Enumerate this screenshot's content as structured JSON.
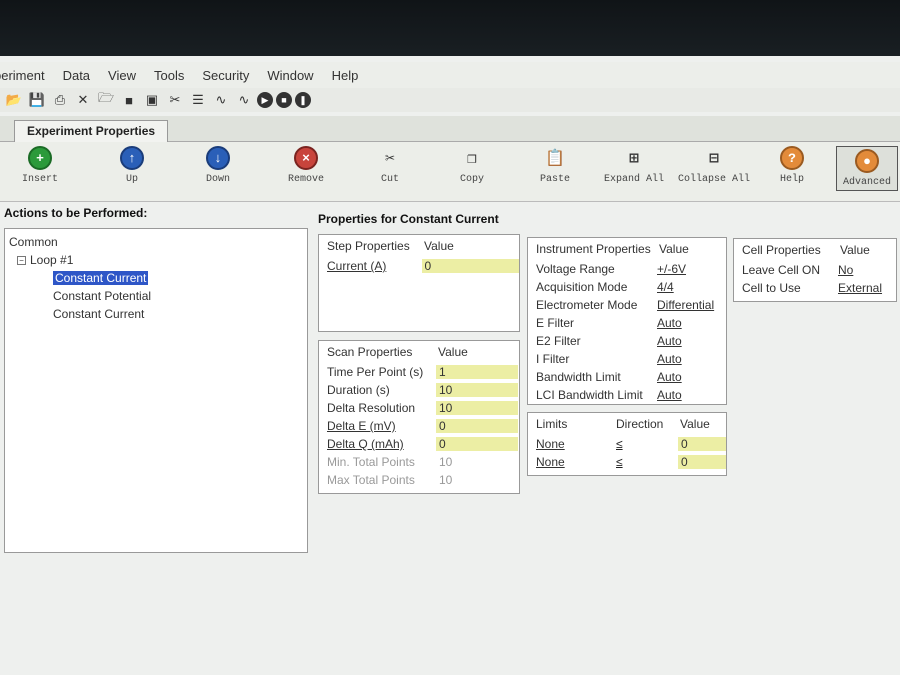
{
  "menu": [
    "periment",
    "Data",
    "View",
    "Tools",
    "Security",
    "Window",
    "Help"
  ],
  "toolbar_small": [
    "folder-open",
    "save",
    "print",
    "cross",
    "open",
    "disk",
    "image",
    "scissors",
    "list",
    "wave-a",
    "wave-b",
    "play",
    "stop",
    "skip"
  ],
  "tab_label": "Experiment Properties",
  "ribbon": {
    "insert": "Insert",
    "up": "Up",
    "down": "Down",
    "remove": "Remove",
    "cut": "Cut",
    "copy": "Copy",
    "paste": "Paste",
    "expand_all": "Expand All",
    "collapse_all": "Collapse All",
    "help": "Help",
    "advanced": "Advanced"
  },
  "actions_title": "Actions to be Performed:",
  "tree": {
    "root": "Common",
    "loop": "Loop #1",
    "items": [
      "Constant Current",
      "Constant Potential",
      "Constant Current"
    ]
  },
  "props_title": "Properties for Constant Current",
  "step": {
    "h1": "Step Properties",
    "h2": "Value",
    "rows": [
      {
        "k": "Current (A)",
        "v": "0"
      }
    ]
  },
  "scan": {
    "h1": "Scan Properties",
    "h2": "Value",
    "rows": [
      {
        "k": "Time Per Point (s)",
        "v": "1"
      },
      {
        "k": "Duration (s)",
        "v": "10"
      },
      {
        "k": "Delta Resolution",
        "v": "10"
      },
      {
        "k": "Delta E (mV)",
        "v": "0"
      },
      {
        "k": "Delta Q (mAh)",
        "v": "0"
      },
      {
        "k": "Min. Total Points",
        "v": "10"
      },
      {
        "k": "Max Total Points",
        "v": "10"
      }
    ]
  },
  "instrument": {
    "h1": "Instrument Properties",
    "h2": "Value",
    "rows": [
      {
        "k": "Voltage Range",
        "v": "+/-6V"
      },
      {
        "k": "Acquisition Mode",
        "v": "4/4"
      },
      {
        "k": "Electrometer Mode",
        "v": "Differential"
      },
      {
        "k": "E Filter",
        "v": "Auto"
      },
      {
        "k": "E2 Filter",
        "v": "Auto"
      },
      {
        "k": "I Filter",
        "v": "Auto"
      },
      {
        "k": "Bandwidth Limit",
        "v": "Auto"
      },
      {
        "k": "LCI Bandwidth Limit",
        "v": "Auto"
      }
    ]
  },
  "limits": {
    "h1": "Limits",
    "h2": "Direction",
    "h3": "Value",
    "rows": [
      {
        "k": "None",
        "d": "≤",
        "v": "0"
      },
      {
        "k": "None",
        "d": "≤",
        "v": "0"
      }
    ]
  },
  "cell": {
    "h1": "Cell Properties",
    "h2": "Value",
    "rows": [
      {
        "k": "Leave Cell ON",
        "v": "No"
      },
      {
        "k": "Cell to Use",
        "v": "External"
      }
    ]
  }
}
